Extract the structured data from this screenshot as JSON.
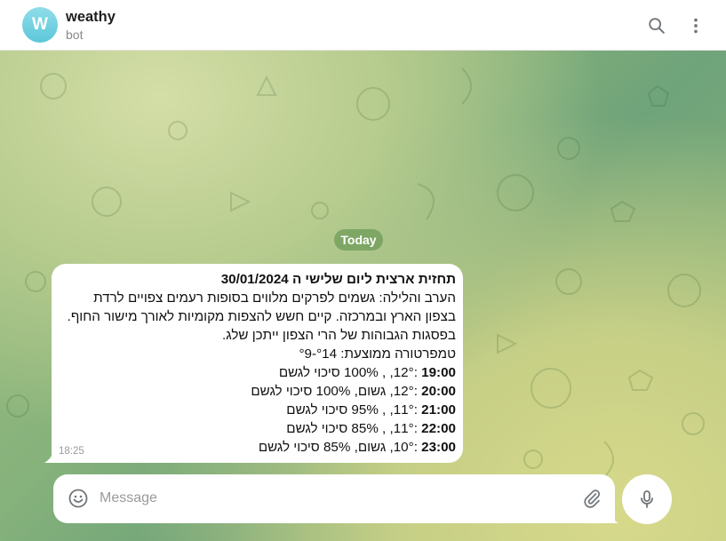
{
  "header": {
    "avatar_letter": "W",
    "title": "weathy",
    "subtitle": "bot"
  },
  "chat": {
    "date_separator": "Today",
    "message": {
      "title": "תחזית ארצית ליום שלישי ה 30/01/2024",
      "description": "הערב והלילה: גשמים לפרקים מלווים בסופות רעמים צפויים לרדת בצפון הארץ ובמרכזה. קיים חשש להצפות מקומיות לאורך מישור החוף. בפסגות הגבוהות של הרי הצפון ייתכן שלג.",
      "temperature": "טמפרטורה ממוצעת: °14-°9",
      "hours": [
        {
          "time": "19:00",
          "text": " :12°, , 100% סיכוי לגשם"
        },
        {
          "time": "20:00",
          "text": " :12°, גשום, 100% סיכוי לגשם"
        },
        {
          "time": "21:00",
          "text": " :11°, , 95% סיכוי לגשם"
        },
        {
          "time": "22:00",
          "text": " :11°, , 85% סיכוי לגשם"
        },
        {
          "time": "23:00",
          "text": " :10°, גשום, 85% סיכוי לגשם"
        }
      ],
      "timestamp": "18:25"
    }
  },
  "composer": {
    "placeholder": "Message"
  },
  "colors": {
    "accent": "#5cc7d9",
    "date_pill": "#6a9a55"
  },
  "icons": [
    "search-icon",
    "more-vertical-icon",
    "emoji-icon",
    "paperclip-icon",
    "microphone-icon"
  ]
}
